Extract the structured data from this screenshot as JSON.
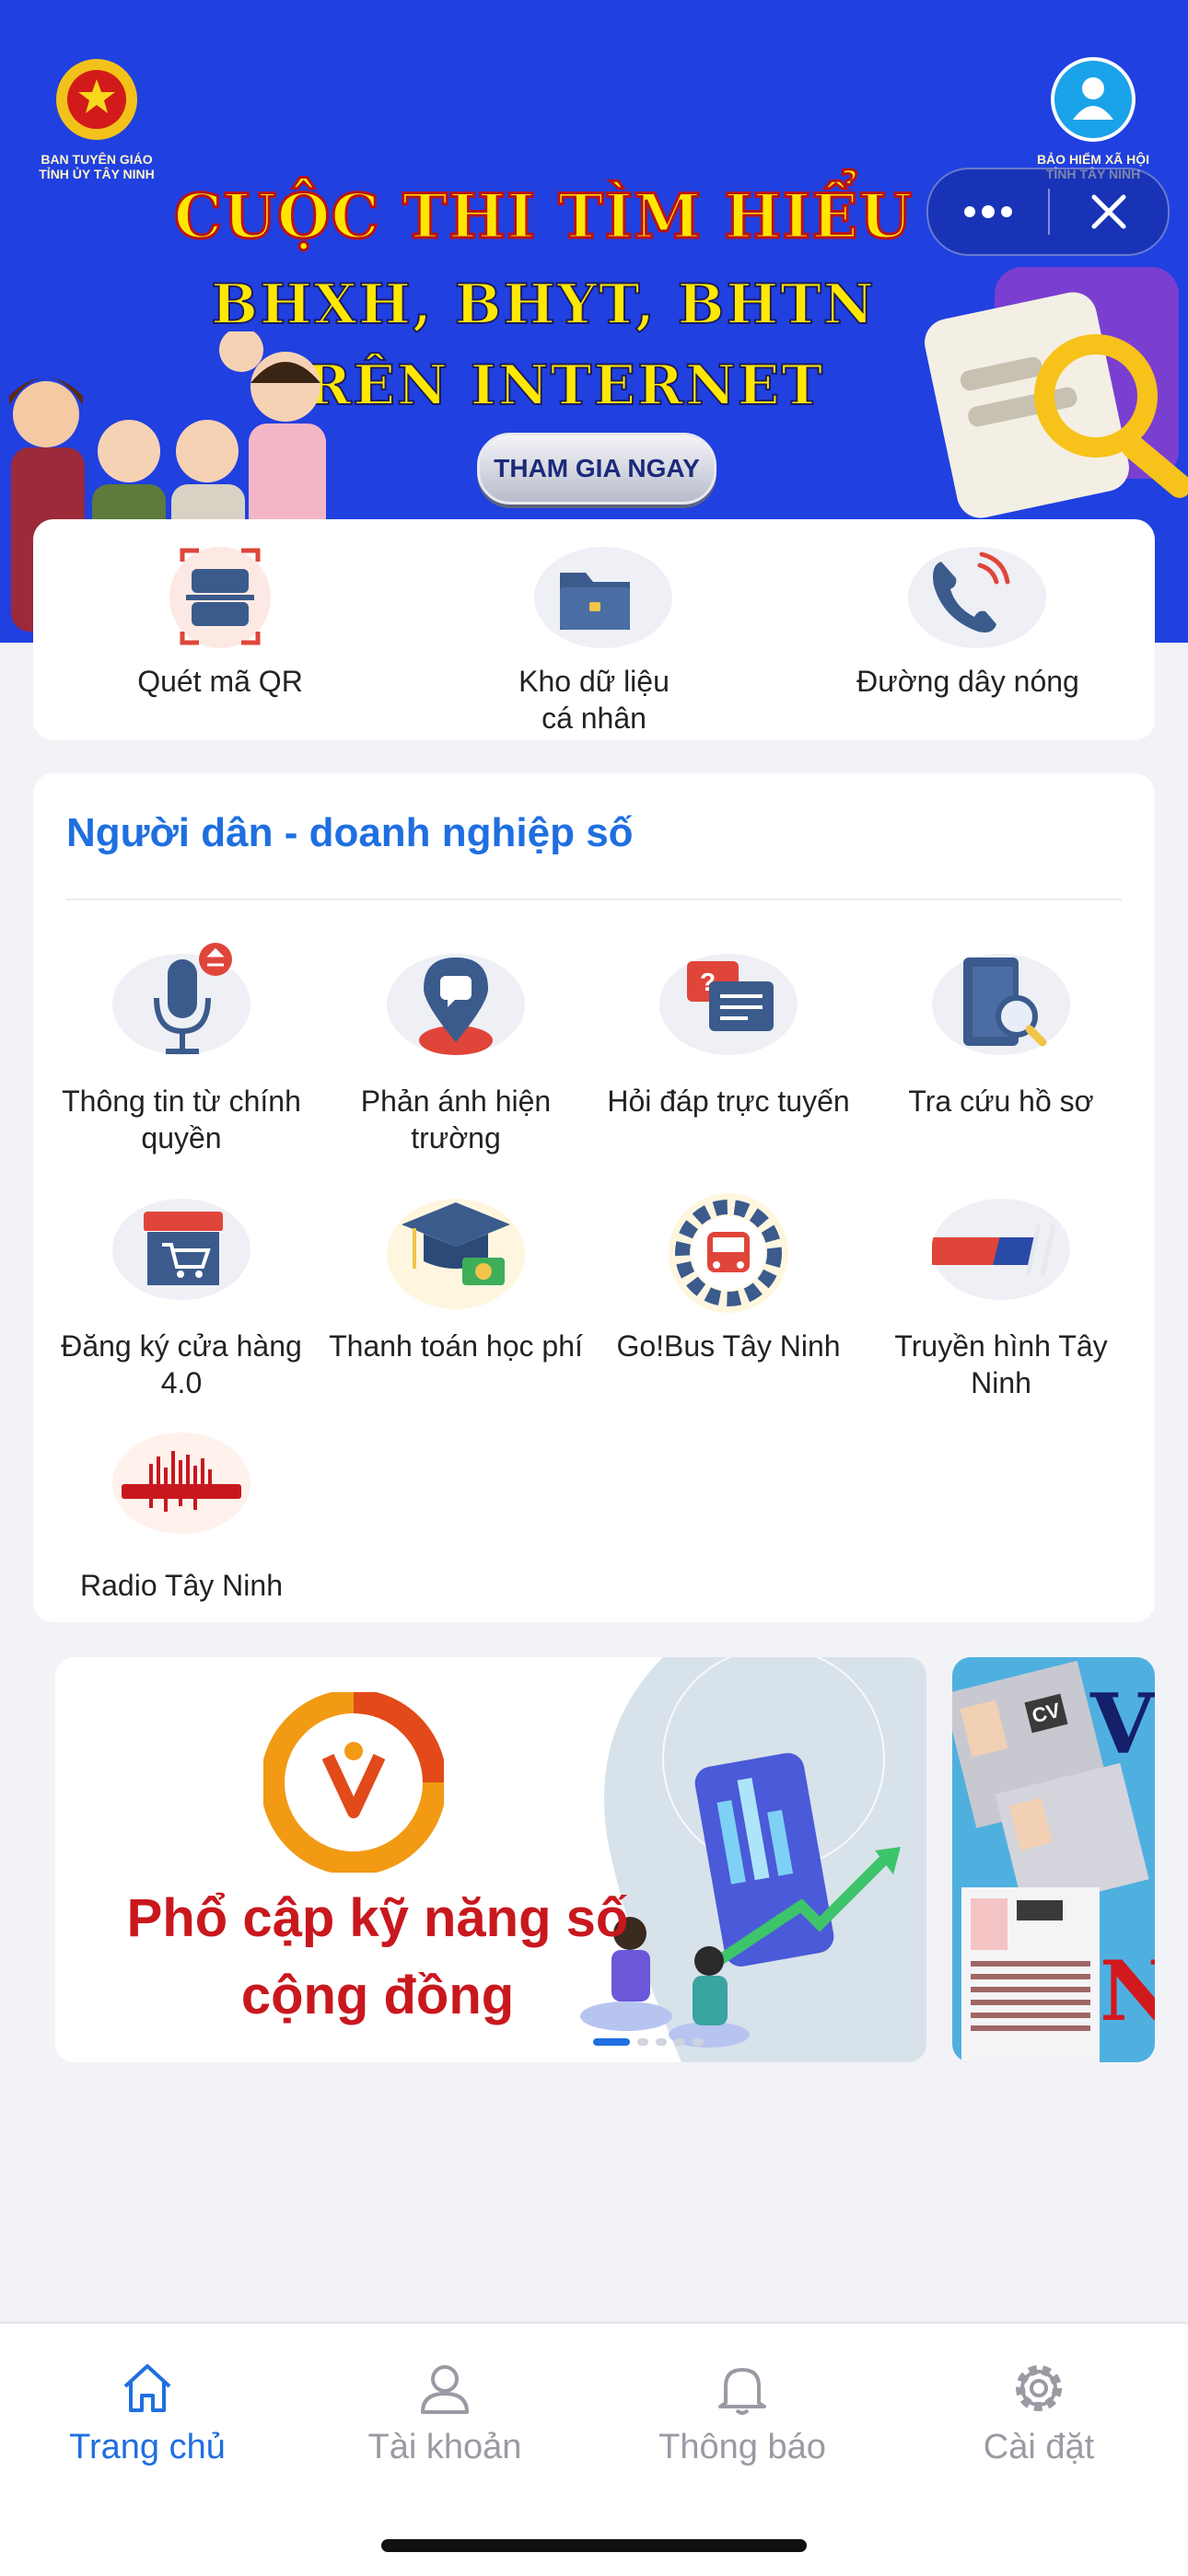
{
  "banner": {
    "left_org": "BAN TUYÊN GIÁO TỈNH ỦY TÂY NINH",
    "right_org": "BẢO HIỂM XÃ HỘI TỈNH TÂY NINH",
    "headline_1": "CUỘC THI TÌM HIỂU",
    "headline_2": "BHXH, BHYT, BHTN",
    "headline_3": "TRÊN INTERNET",
    "cta": "THAM GIA NGAY"
  },
  "capsule": {
    "more_icon": "more-dots-icon",
    "close_icon": "close-icon"
  },
  "quick_actions": [
    {
      "label": "Quét mã QR",
      "icon": "qr-scan-icon"
    },
    {
      "label": "Kho dữ liệu cá nhân",
      "icon": "folder-icon"
    },
    {
      "label": "Đường dây nóng",
      "icon": "phone-call-icon"
    }
  ],
  "services": {
    "title": "Người dân - doanh nghiệp số",
    "items": [
      {
        "label": "Thông tin từ chính quyền",
        "icon": "microphone-icon"
      },
      {
        "label": "Phản ánh hiện trường",
        "icon": "map-pin-chat-icon"
      },
      {
        "label": "Hỏi đáp trực tuyến",
        "icon": "chat-question-icon"
      },
      {
        "label": "Tra cứu hồ sơ",
        "icon": "document-search-icon"
      },
      {
        "label": "Đăng ký cửa hàng 4.0",
        "icon": "shop-cart-icon"
      },
      {
        "label": "Thanh toán học phí",
        "icon": "graduation-money-icon"
      },
      {
        "label": "Go!Bus Tây Ninh",
        "icon": "bus-gear-icon"
      },
      {
        "label": "Truyền hình Tây Ninh",
        "icon": "ttv-logo-icon"
      },
      {
        "label": "Radio Tây Ninh",
        "icon": "radio-fm-icon"
      }
    ]
  },
  "carousel": {
    "slide_1_line_1": "Phổ cập kỹ năng số",
    "slide_1_line_2": "cộng đồng",
    "slide_2_letters": "V",
    "slide_2_letter_bottom": "N",
    "cv_tag": "CV"
  },
  "tabbar": {
    "tabs": [
      {
        "label": "Trang chủ",
        "icon": "home-icon",
        "active": true
      },
      {
        "label": "Tài khoản",
        "icon": "user-icon",
        "active": false
      },
      {
        "label": "Thông báo",
        "icon": "bell-icon",
        "active": false
      },
      {
        "label": "Cài đặt",
        "icon": "gear-icon",
        "active": false
      }
    ]
  },
  "colors": {
    "banner_bg": "#2040e0",
    "accent": "#1f6fe0",
    "promo_red": "#c8181e",
    "inactive_tab": "#9a9aa4"
  }
}
